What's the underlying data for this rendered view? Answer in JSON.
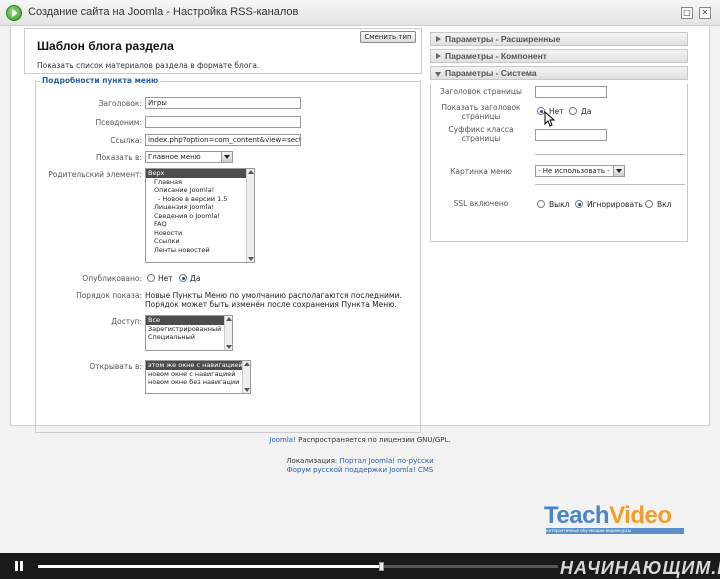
{
  "window": {
    "title": "Создание сайта на Joomla - Настройка RSS-каналов",
    "minimize": "□",
    "close": "✕"
  },
  "header": {
    "title": "Шаблон блога раздела",
    "description": "Показать список материалов раздела в формате блога.",
    "change_type_button": "Сменить тип"
  },
  "details": {
    "legend": "Подробности пункта меню",
    "title_label": "Заголовок:",
    "title_value": "Игры",
    "alias_label": "Псевдоним:",
    "alias_value": "",
    "link_label": "Ссылка:",
    "link_value": "index.php?option=com_content&view=section&",
    "show_in_label": "Показать в:",
    "show_in_value": "Главное меню",
    "parent_label": "Родительский элемент:",
    "parent_items": [
      "Верх",
      "Главная",
      "Описание Joomla!",
      "- Новое в версии 1.5",
      "Лицензия Joomla!",
      "Сведения о Joomla!",
      "FAQ",
      "Новости",
      "Ссылки",
      "Ленты новостей"
    ],
    "published_label": "Опубликовано:",
    "published_no": "Нет",
    "published_yes": "Да",
    "order_label": "Порядок показа:",
    "order_text": "Новые Пункты Меню по умолчанию располагаются последними. Порядок может быть изменён после сохранения Пункта Меню.",
    "access_label": "Доступ:",
    "access_items": [
      "Все",
      "Зарегистрированный",
      "Специальный"
    ],
    "open_in_label": "Открывать в:",
    "open_in_items": [
      "этом же окне с навигацией",
      "новом окне с навигацией",
      "новом окне без навигации"
    ]
  },
  "params": {
    "advanced": "Параметры - Расширенные",
    "component": "Параметры - Компонент",
    "system": "Параметры - Система",
    "page_title_label": "Заголовок страницы",
    "show_page_title_label_1": "Показать заголовок",
    "show_page_title_label_2": "страницы",
    "show_no": "Нет",
    "show_yes": "Да",
    "suffix_label_1": "Суффикс класса",
    "suffix_label_2": "страницы",
    "menu_image_label": "Картинка меню",
    "menu_image_value": "- Не использовать -",
    "ssl_label": "SSL включено",
    "ssl_off": "Выкл",
    "ssl_ignore": "Игнорировать",
    "ssl_on": "Вкл"
  },
  "footer": {
    "joomla_link": "Joomla!",
    "license_text": " Распространяется по лицензии GNU/GPL.",
    "localization_label": "Локализация: ",
    "localization_link": "Портал Joomla! по-русски",
    "forum_link": "Форум русской поддержки Joomla! CMS"
  },
  "branding": {
    "teach": "Teach",
    "video": "Video",
    "tagline": "интерактивные обучающие видеокурсы",
    "watermark": "НАЧИНАЮЩИМ.РФ"
  },
  "player": {
    "progress": 0.66
  }
}
